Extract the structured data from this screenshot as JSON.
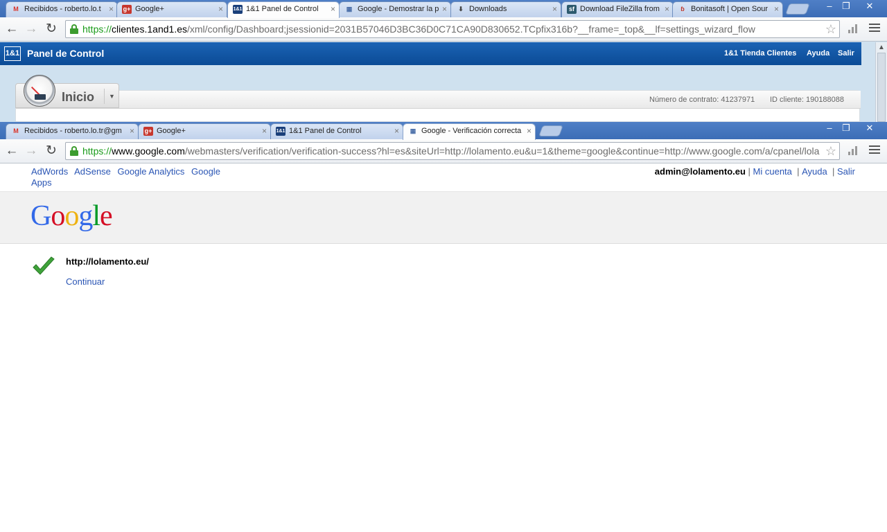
{
  "back_window": {
    "tabs": [
      {
        "title": "Recibidos - roberto.lo.t",
        "icon": "gmail-icon",
        "icon_text": "M"
      },
      {
        "title": "Google+",
        "icon": "google-plus-icon",
        "icon_text": "g+"
      },
      {
        "title": "1&1 Panel de Control",
        "icon": "oneandone-icon",
        "icon_text": "1&1"
      },
      {
        "title": "Google - Demostrar la p",
        "icon": "google-page-icon",
        "icon_text": "▦"
      },
      {
        "title": "Downloads",
        "icon": "download-icon",
        "icon_text": "⬇"
      },
      {
        "title": "Download FileZilla from",
        "icon": "sourceforge-icon",
        "icon_text": "sf"
      },
      {
        "title": "Bonitasoft | Open Sour",
        "icon": "bonitasoft-icon",
        "icon_text": "ɓ"
      }
    ],
    "url": {
      "scheme": "https://",
      "host": "clientes.1and1.es",
      "path": "/xml/config/Dashboard;jsessionid=2031B57046D3BC36D0C71CA90D830652.TCpfix316b?__frame=_top&__lf=settings_wizard_flow"
    },
    "panel": {
      "logo": "1&1",
      "title": "Panel de Control",
      "links": [
        "1&1 Tienda Clientes",
        "Ayuda",
        "Salir"
      ],
      "section": "Inicio",
      "contract": "Número de contrato: 41237971",
      "client_id": "ID cliente: 190188088"
    }
  },
  "front_window": {
    "tabs": [
      {
        "title": "Recibidos - roberto.lo.tr@gm",
        "icon": "gmail-icon",
        "icon_text": "M"
      },
      {
        "title": "Google+",
        "icon": "google-plus-icon",
        "icon_text": "g+"
      },
      {
        "title": "1&1 Panel de Control",
        "icon": "oneandone-icon",
        "icon_text": "1&1"
      },
      {
        "title": "Google - Verificación correcta",
        "icon": "google-page-icon",
        "icon_text": "▦"
      }
    ],
    "url": {
      "scheme": "https://",
      "host": "www.google.com",
      "path": "/webmasters/verification/verification-success?hl=es&siteUrl=http://lolamento.eu&u=1&theme=google&continue=http://www.google.com/a/cpanel/lola"
    },
    "page": {
      "top_links": [
        "AdWords",
        "AdSense",
        "Google Analytics",
        "Google Apps"
      ],
      "user_email": "admin@lolamento.eu",
      "user_links": [
        "Mi cuenta",
        "Ayuda",
        "Salir"
      ],
      "logo_letters": [
        "G",
        "o",
        "o",
        "g",
        "l",
        "e"
      ],
      "logo_colors": [
        "#3369e8",
        "#d50f25",
        "#eeb211",
        "#3369e8",
        "#009925",
        "#d50f25"
      ],
      "site_url": "http://lolamento.eu/",
      "continue_label": "Continuar"
    }
  },
  "colors": {
    "accent_link": "#2a55b4",
    "panel_blue": "#0b4b96",
    "secure_green": "#1a9b1a"
  }
}
